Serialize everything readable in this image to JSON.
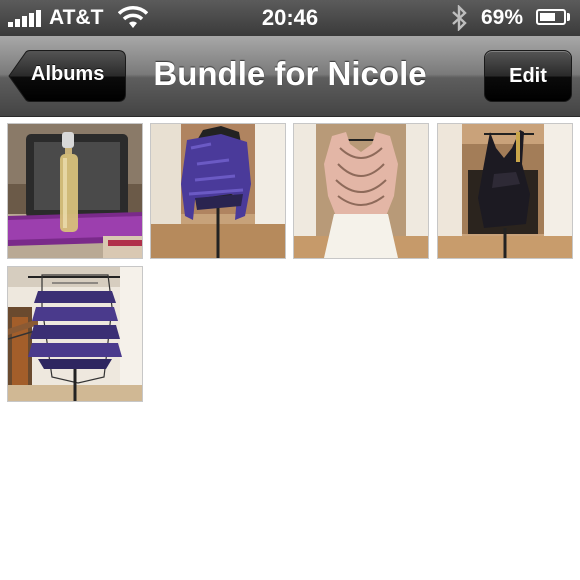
{
  "status_bar": {
    "carrier": "AT&T",
    "time": "20:46",
    "battery_percent_label": "69%",
    "battery_level": 0.69,
    "icons": [
      "signal-icon",
      "wifi-icon",
      "bluetooth-icon",
      "battery-icon"
    ]
  },
  "nav": {
    "back_label": "Albums",
    "title": "Bundle for Nicole",
    "edit_label": "Edit"
  },
  "photos": [
    {
      "subject": "perfume bottle on purple mat"
    },
    {
      "subject": "purple lace top on dress form"
    },
    {
      "subject": "pink and white lace dress on dress form"
    },
    {
      "subject": "black dress on dress form"
    },
    {
      "subject": "purple ruffled top on dress form"
    }
  ]
}
